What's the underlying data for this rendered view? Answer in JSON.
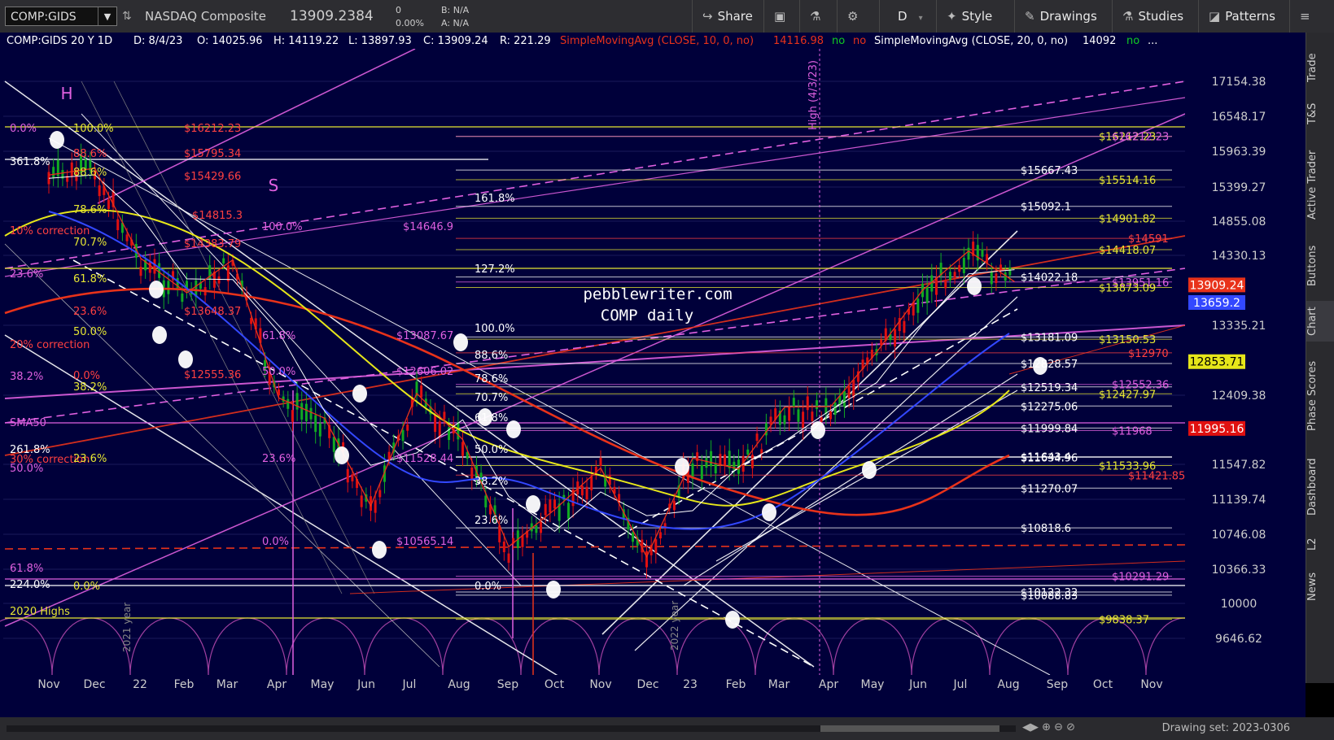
{
  "toolbar": {
    "symbol": "COMP:GIDS",
    "name": "NASDAQ Composite",
    "price": "13909.2384",
    "change": "0",
    "change_pct": "0.00%",
    "bid": "B: N/A",
    "ask": "A: N/A",
    "buttons": [
      {
        "label": "Share",
        "icon": "share-icon"
      },
      {
        "label": "",
        "icon": "screenshot-icon"
      },
      {
        "label": "",
        "icon": "flask-icon"
      },
      {
        "label": "",
        "icon": "gear-icon"
      },
      {
        "label": "D",
        "icon": ""
      },
      {
        "label": "Style",
        "icon": "style-icon"
      },
      {
        "label": "Drawings",
        "icon": "drawings-icon"
      },
      {
        "label": "Studies",
        "icon": "studies-icon"
      },
      {
        "label": "Patterns",
        "icon": "patterns-icon"
      },
      {
        "label": "",
        "icon": "menu-icon"
      }
    ]
  },
  "header_line": {
    "symbol": "COMP:GIDS 20 Y 1D",
    "d": "D: 8/4/23",
    "o": "O: 14025.96",
    "h": "H: 14119.22",
    "l": "L: 13897.93",
    "c": "C: 13909.24",
    "r": "R: 221.29",
    "sma10": "SimpleMovingAvg (CLOSE, 10, 0, no)",
    "sma10_val": "14116.98",
    "sma10_flag1": "no",
    "sma10_flag2": "no",
    "sma20": "SimpleMovingAvg (CLOSE, 20, 0, no)",
    "sma20_val": "14092",
    "sma20_flag": "no",
    "more": "..."
  },
  "sidebar_tabs": [
    "Trade",
    "T&S",
    "Active Trader",
    "Buttons",
    "Chart",
    "Phase Scores",
    "Dashboard",
    "L2",
    "News"
  ],
  "drawing_set": "Drawing set: 2023-0306",
  "watermark": [
    "pebblewriter.com",
    "COMP daily"
  ],
  "colors": {
    "background": "#00003a",
    "up_candle": "#11aa22",
    "down_candle": "#e01010",
    "sma200": "#e8321a",
    "sma100": "#e6e61a",
    "sma50": "#3348ff",
    "fib_yellow": "#e6e633",
    "fib_magenta": "#e060e0",
    "white": "#ffffff",
    "red_label": "#ff4040"
  },
  "chart_data": {
    "type": "candlestick",
    "title": "COMP:GIDS 20 Y 1D",
    "y_ticks": [
      "17154.38",
      "16548.17",
      "15963.39",
      "15399.27",
      "14855.08",
      "14330.13",
      "13335.21",
      "12409.38",
      "11547.82",
      "11139.74",
      "10746.08",
      "10366.33",
      "10000",
      "9646.62"
    ],
    "x_ticks": [
      "Nov",
      "Dec",
      "22",
      "Feb",
      "Mar",
      "Apr",
      "May",
      "Jun",
      "Jul",
      "Aug",
      "Sep",
      "Oct",
      "Nov",
      "Dec",
      "23",
      "Feb",
      "Mar",
      "Apr",
      "May",
      "Jun",
      "Jul",
      "Aug",
      "Sep",
      "Oct",
      "Nov"
    ],
    "price_tags": [
      {
        "value": 13909.24,
        "label": "13909.24",
        "bg": "#e8321a",
        "fg": "#ffffff"
      },
      {
        "value": 13659.2,
        "label": "13659.2",
        "bg": "#3348ff",
        "fg": "#ffffff"
      },
      {
        "value": 12853.71,
        "label": "12853.71",
        "bg": "#e6e61a",
        "fg": "#000000"
      },
      {
        "value": 11995.16,
        "label": "11995.16",
        "bg": "#e01010",
        "fg": "#ffffff"
      }
    ],
    "closes_monthly": [
      {
        "m": "2021-11",
        "c": 15537
      },
      {
        "m": "2021-12",
        "c": 15645
      },
      {
        "m": "2022-01",
        "c": 14240
      },
      {
        "m": "2022-02",
        "c": 13751
      },
      {
        "m": "2022-03",
        "c": 14220
      },
      {
        "m": "2022-04",
        "c": 12335
      },
      {
        "m": "2022-05",
        "c": 12081
      },
      {
        "m": "2022-06",
        "c": 11029
      },
      {
        "m": "2022-07",
        "c": 12391
      },
      {
        "m": "2022-08",
        "c": 11816
      },
      {
        "m": "2022-09",
        "c": 10576
      },
      {
        "m": "2022-10",
        "c": 10988
      },
      {
        "m": "2022-11",
        "c": 11468
      },
      {
        "m": "2022-12",
        "c": 10466
      },
      {
        "m": "2023-01",
        "c": 11585
      },
      {
        "m": "2023-02",
        "c": 11456
      },
      {
        "m": "2023-03",
        "c": 12222
      },
      {
        "m": "2023-04",
        "c": 12227
      },
      {
        "m": "2023-05",
        "c": 12935
      },
      {
        "m": "2023-06",
        "c": 13788
      },
      {
        "m": "2023-07",
        "c": 14346
      },
      {
        "m": "2023-08",
        "c": 13909
      }
    ],
    "right_labels": [
      {
        "value": 16212.23,
        "text": "$16212.23",
        "color": "#e6e633"
      },
      {
        "value": 16212.23,
        "text": "$16212.23",
        "color": "#e060e0"
      },
      {
        "value": 15667.43,
        "text": "$15667.43",
        "color": "#ffffff"
      },
      {
        "value": 15514.16,
        "text": "$15514.16",
        "color": "#e6e633"
      },
      {
        "value": 15092.1,
        "text": "$15092.1",
        "color": "#ffffff"
      },
      {
        "value": 14901.82,
        "text": "$14901.82",
        "color": "#e6e633"
      },
      {
        "value": 14591,
        "text": "$14591",
        "color": "#ff4040"
      },
      {
        "value": 14418.07,
        "text": "$14418.07",
        "color": "#e6e633"
      },
      {
        "value": 14022.18,
        "text": "$14022.18",
        "color": "#ffffff"
      },
      {
        "value": 13951.16,
        "text": "$13951.16",
        "color": "#e060e0"
      },
      {
        "value": 13873.09,
        "text": "$13873.09",
        "color": "#e6e633"
      },
      {
        "value": 13181.09,
        "text": "$13181.09",
        "color": "#ffffff"
      },
      {
        "value": 13150.53,
        "text": "$13150.53",
        "color": "#e6e633"
      },
      {
        "value": 12970,
        "text": "$12970",
        "color": "#ff4040"
      },
      {
        "value": 12828.57,
        "text": "$12828.57",
        "color": "#ffffff"
      },
      {
        "value": 12552.36,
        "text": "$12552.36",
        "color": "#e060e0"
      },
      {
        "value": 12519.34,
        "text": "$12519.34",
        "color": "#ffffff"
      },
      {
        "value": 12427.97,
        "text": "$12427.97",
        "color": "#e6e633"
      },
      {
        "value": 12275.06,
        "text": "$12275.06",
        "color": "#ffffff"
      },
      {
        "value": 11999.84,
        "text": "$11999.84",
        "color": "#ffffff"
      },
      {
        "value": 11968,
        "text": "$11968",
        "color": "#e060e0"
      },
      {
        "value": 11643.4,
        "text": "$11643.4",
        "color": "#ffffff"
      },
      {
        "value": 11634.96,
        "text": "$11634.96",
        "color": "#ffffff"
      },
      {
        "value": 11533.96,
        "text": "$11533.96",
        "color": "#e6e633"
      },
      {
        "value": 11421.85,
        "text": "$11421.85",
        "color": "#ff4040"
      },
      {
        "value": 11270.07,
        "text": "$11270.07",
        "color": "#ffffff"
      },
      {
        "value": 10818.6,
        "text": "$10818.6",
        "color": "#ffffff"
      },
      {
        "value": 10291.29,
        "text": "$10291.29",
        "color": "#e060e0"
      },
      {
        "value": 10122.32,
        "text": "$10122.32",
        "color": "#ffffff"
      },
      {
        "value": 10088.83,
        "text": "$10088.83",
        "color": "#ffffff"
      },
      {
        "value": 9838.37,
        "text": "$9838.37",
        "color": "#e6e633"
      }
    ],
    "left_labels": [
      {
        "text": "0.0%",
        "color": "#e060e0"
      },
      {
        "text": "100.0%",
        "color": "#e6e633"
      },
      {
        "text": "$16212.23",
        "color": "#ff4040"
      },
      {
        "text": "88.6%",
        "color": "#ff4040"
      },
      {
        "text": "$15795.34",
        "color": "#ff4040"
      },
      {
        "text": "361.8%",
        "color": "#ffffff"
      },
      {
        "text": "88.6%",
        "color": "#e6e633"
      },
      {
        "text": "$15429.66",
        "color": "#ff4040"
      },
      {
        "text": "78.6%",
        "color": "#e6e633"
      },
      {
        "text": "$14815.3",
        "color": "#ff4040"
      },
      {
        "text": "10% correction",
        "color": "#ff4040"
      },
      {
        "text": "70.7%",
        "color": "#e6e633"
      },
      {
        "text": "$14383.79",
        "color": "#ff4040"
      },
      {
        "text": "23.6%",
        "color": "#e060e0"
      },
      {
        "text": "61.8%",
        "color": "#e6e633"
      },
      {
        "text": "23.6%",
        "color": "#ff4040"
      },
      {
        "text": "$13648.37",
        "color": "#ff4040"
      },
      {
        "text": "50.0%",
        "color": "#e6e633"
      },
      {
        "text": "20% correction",
        "color": "#ff4040"
      },
      {
        "text": "38.2%",
        "color": "#e060e0"
      },
      {
        "text": "0.0%",
        "color": "#ff4040"
      },
      {
        "text": "$12555.36",
        "color": "#ff4040"
      },
      {
        "text": "38.2%",
        "color": "#e6e633"
      },
      {
        "text": "SMA50",
        "color": "#e060e0"
      },
      {
        "text": "261.8%",
        "color": "#ffffff"
      },
      {
        "text": "30% correction",
        "color": "#ff4040"
      },
      {
        "text": "50.0%",
        "color": "#e060e0"
      },
      {
        "text": "23.6%",
        "color": "#e6e633"
      },
      {
        "text": "61.8%",
        "color": "#e060e0"
      },
      {
        "text": "224.0%",
        "color": "#ffffff"
      },
      {
        "text": "0.0%",
        "color": "#e6e633"
      },
      {
        "text": "2020 Highs",
        "color": "#e6e633"
      }
    ],
    "mid_labels": [
      {
        "text": "161.8%",
        "color": "#ffffff"
      },
      {
        "text": "100.0%",
        "color": "#e060e0"
      },
      {
        "text": "$14646.9",
        "color": "#e060e0"
      },
      {
        "text": "127.2%",
        "color": "#ffffff"
      },
      {
        "text": "100.0%",
        "color": "#ffffff"
      },
      {
        "text": "61.8%",
        "color": "#e060e0"
      },
      {
        "text": "$13087.67",
        "color": "#e060e0"
      },
      {
        "text": "88.6%",
        "color": "#ffffff"
      },
      {
        "text": "50.0%",
        "color": "#e060e0"
      },
      {
        "text": "$12606.02",
        "color": "#e060e0"
      },
      {
        "text": "78.6%",
        "color": "#ffffff"
      },
      {
        "text": "70.7%",
        "color": "#ffffff"
      },
      {
        "text": "61.8%",
        "color": "#ffffff"
      },
      {
        "text": "50.0%",
        "color": "#ffffff"
      },
      {
        "text": "23.6%",
        "color": "#e060e0"
      },
      {
        "text": "$11528.44",
        "color": "#e060e0"
      },
      {
        "text": "38.2%",
        "color": "#ffffff"
      },
      {
        "text": "23.6%",
        "color": "#ffffff"
      },
      {
        "text": "0.0%",
        "color": "#e060e0"
      },
      {
        "text": "$10565.14",
        "color": "#e060e0"
      },
      {
        "text": "0.0%",
        "color": "#ffffff"
      }
    ],
    "annotations": [
      {
        "text": "H",
        "color": "#e060e0"
      },
      {
        "text": "S",
        "color": "#e060e0"
      },
      {
        "text": "High (4/3/23)",
        "color": "#e060e0"
      },
      {
        "text": "2021 year",
        "color": "#888888"
      },
      {
        "text": "2022 year",
        "color": "#888888"
      }
    ]
  }
}
